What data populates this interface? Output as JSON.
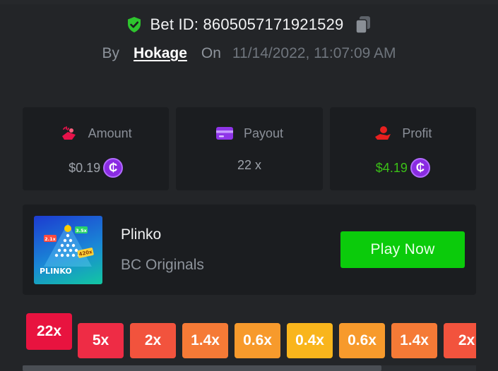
{
  "bet": {
    "id_text": "Bet ID: 8605057171921529",
    "by_label": "By",
    "username": "Hokage",
    "on_label": "On",
    "datetime": "11/14/2022, 11:07:09 AM"
  },
  "stats": {
    "amount": {
      "label": "Amount",
      "value": "$0.19",
      "icon": "money-hand-icon",
      "coin": "₵"
    },
    "payout": {
      "label": "Payout",
      "value": "22 x",
      "icon": "card-icon"
    },
    "profit": {
      "label": "Profit",
      "value": "$4.19",
      "icon": "profit-hand-icon",
      "coin": "₵"
    }
  },
  "game": {
    "name": "Plinko",
    "provider": "BC Originals",
    "play_label": "Play Now",
    "thumb_title": "PLINKO",
    "thumb_tags": [
      "2.1x",
      "3.5x",
      "420x"
    ]
  },
  "multipliers": [
    {
      "label": "22x",
      "color": "#e8133f",
      "active": true
    },
    {
      "label": "5x",
      "color": "#ee2c45"
    },
    {
      "label": "2x",
      "color": "#f2533d"
    },
    {
      "label": "1.4x",
      "color": "#f57a36"
    },
    {
      "label": "0.6x",
      "color": "#f79a2c"
    },
    {
      "label": "0.4x",
      "color": "#f9b51c"
    },
    {
      "label": "0.6x",
      "color": "#f79a2c"
    },
    {
      "label": "1.4x",
      "color": "#f57a36"
    },
    {
      "label": "2x",
      "color": "#f2533d"
    }
  ],
  "colors": {
    "accent_green": "#0bcb0b",
    "profit_green": "#3bc117",
    "coin_purple": "#8a2be2",
    "background": "#232528",
    "card": "#1b1d20"
  }
}
